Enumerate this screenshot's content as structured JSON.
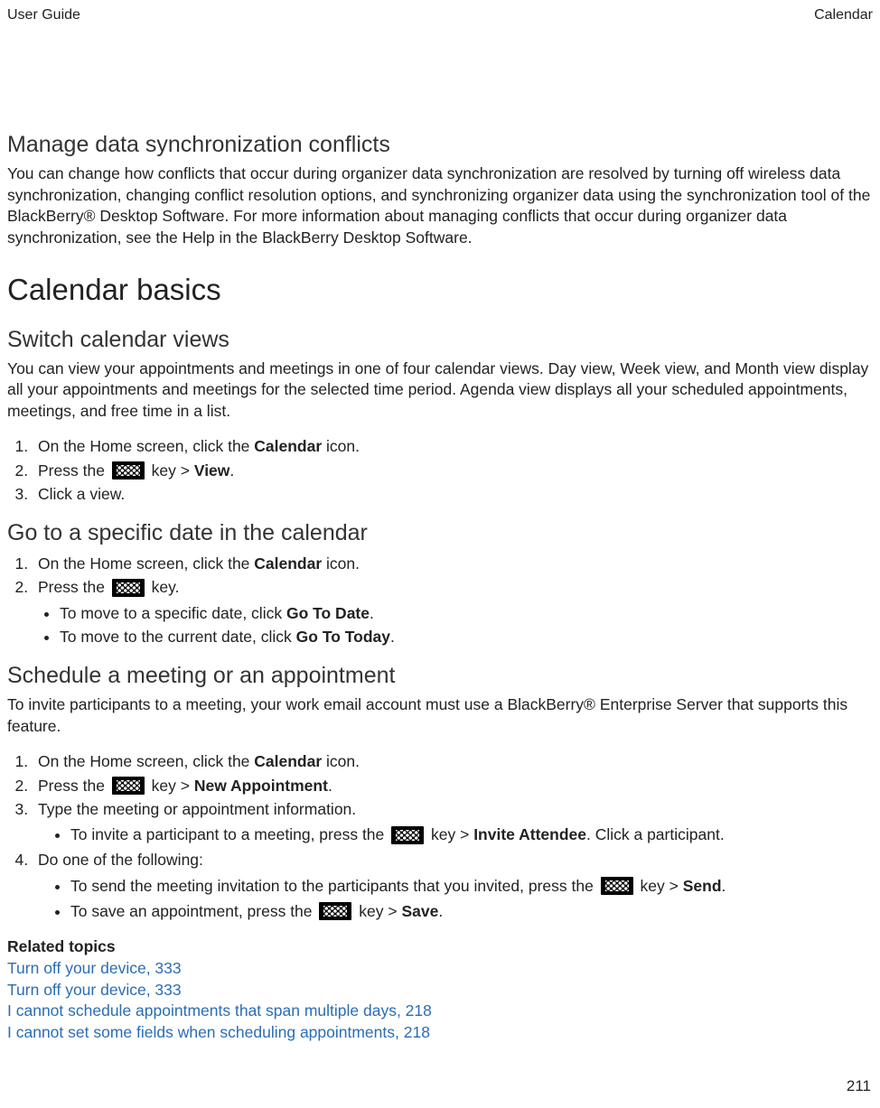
{
  "header": {
    "left": "User Guide",
    "right": "Calendar"
  },
  "page_number": "211",
  "sections": {
    "manage_conflicts": {
      "heading": "Manage data synchronization conflicts",
      "body": "You can change how conflicts that occur during organizer data synchronization are resolved by turning off wireless data synchronization, changing conflict resolution options, and synchronizing organizer data using the synchronization tool of the BlackBerry® Desktop Software. For more information about managing conflicts that occur during organizer data synchronization, see the Help in the BlackBerry Desktop Software."
    },
    "calendar_basics": {
      "heading": "Calendar basics"
    },
    "switch_views": {
      "heading": "Switch calendar views",
      "body": "You can view your appointments and meetings in one of four calendar views. Day view, Week view, and Month view display all your appointments and meetings for the selected time period. Agenda view displays all your scheduled appointments, meetings, and free time in a list.",
      "step1_a": "On the Home screen, click the ",
      "step1_bold": "Calendar",
      "step1_b": " icon.",
      "step2_a": "Press the ",
      "step2_b": " key > ",
      "step2_bold": "View",
      "step2_c": ".",
      "step3": "Click a view."
    },
    "goto_date": {
      "heading": "Go to a specific date in the calendar",
      "step1_a": "On the Home screen, click the ",
      "step1_bold": "Calendar",
      "step1_b": " icon.",
      "step2_a": "Press the ",
      "step2_b": " key.",
      "bullet1_a": "To move to a specific date, click ",
      "bullet1_bold": "Go To Date",
      "bullet1_b": ".",
      "bullet2_a": "To move to the current date, click ",
      "bullet2_bold": "Go To Today",
      "bullet2_b": "."
    },
    "schedule": {
      "heading": "Schedule a meeting or an appointment",
      "body": "To invite participants to a meeting, your work email account must use a BlackBerry® Enterprise Server that supports this feature.",
      "step1_a": "On the Home screen, click the ",
      "step1_bold": "Calendar",
      "step1_b": " icon.",
      "step2_a": "Press the ",
      "step2_b": " key > ",
      "step2_bold": "New Appointment",
      "step2_c": ".",
      "step3": "Type the meeting or appointment information.",
      "step3_sub_a": "To invite a participant to a meeting, press the ",
      "step3_sub_b": " key > ",
      "step3_sub_bold": "Invite Attendee",
      "step3_sub_c": ". Click a participant.",
      "step4": "Do one of the following:",
      "step4_sub1_a": "To send the meeting invitation to the participants that you invited, press the ",
      "step4_sub1_b": " key > ",
      "step4_sub1_bold": "Send",
      "step4_sub1_c": ".",
      "step4_sub2_a": "To save an appointment, press the ",
      "step4_sub2_b": " key > ",
      "step4_sub2_bold": "Save",
      "step4_sub2_c": "."
    },
    "related": {
      "heading": "Related topics",
      "links": [
        "Turn off your device, 333",
        "Turn off your device, 333",
        "I cannot schedule appointments that span multiple days, 218",
        "I cannot set some fields when scheduling appointments, 218"
      ]
    }
  }
}
